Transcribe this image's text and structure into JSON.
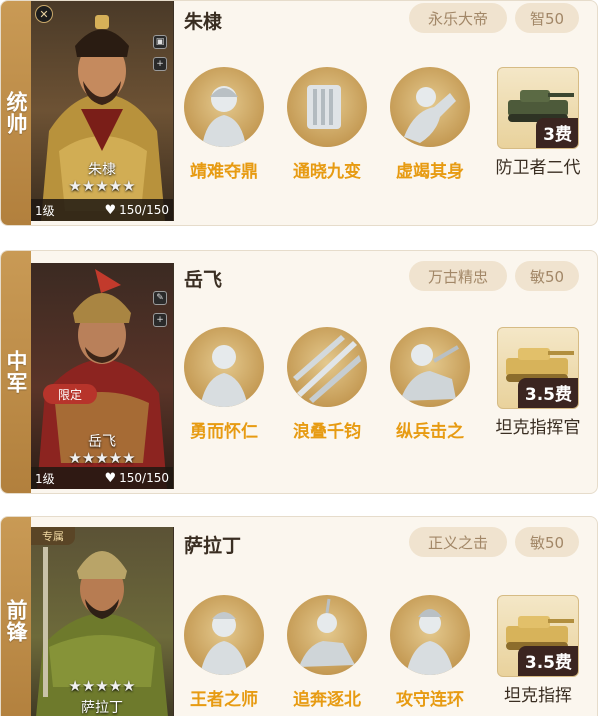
{
  "generals": [
    {
      "role": "统帅",
      "name": "朱棣",
      "portrait_name": "朱棣",
      "stars": "★★★★★",
      "level": "1级",
      "hp": "150/150",
      "title": "永乐大帝",
      "stat": "智50",
      "skills": [
        "靖难夺鼎",
        "通晓九变",
        "虚竭其身"
      ],
      "unit": {
        "name": "防卫者二代",
        "cost": "3费"
      }
    },
    {
      "role": "中军",
      "name": "岳飞",
      "portrait_name": "岳飞",
      "badge": "限定",
      "stars": "★★★★★",
      "level": "1级",
      "hp": "150/150",
      "title": "万古精忠",
      "stat": "敏50",
      "skills": [
        "勇而怀仁",
        "浪叠千钧",
        "纵兵击之"
      ],
      "unit": {
        "name": "坦克指挥官",
        "cost": "3.5费"
      }
    },
    {
      "role": "前锋",
      "name": "萨拉丁",
      "portrait_name": "萨拉丁",
      "badge": "专属",
      "stars": "★★★★★",
      "title": "正义之击",
      "stat": "敏50",
      "skills": [
        "王者之师",
        "追奔逐北",
        "攻守连环"
      ],
      "unit": {
        "name": "坦克指挥",
        "cost": "3.5费"
      }
    }
  ],
  "icons": {
    "heart": "heart-icon",
    "star": "star-icon",
    "corner": "close-icon"
  },
  "colors": {
    "role_strip": "#c99a55",
    "skill_label": "#e79b12",
    "pill_bg": "#f0e3cf",
    "cost_bg": "#3b2520"
  }
}
